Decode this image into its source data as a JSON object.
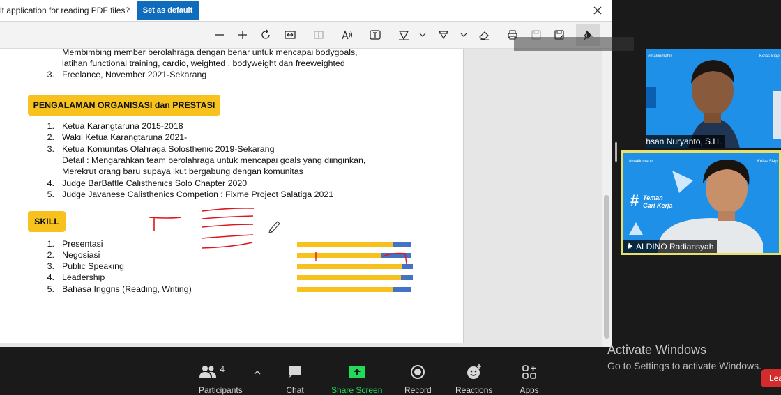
{
  "infobar": {
    "message": "lt application for reading PDF files?",
    "set_default_label": "Set as default"
  },
  "toolbar": {
    "icons": [
      "zoom-out-icon",
      "zoom-in-icon",
      "rotate-icon",
      "fit-page-icon",
      "page-view-icon",
      "read-aloud-icon",
      "text-icon",
      "draw-icon",
      "highlight-icon",
      "eraser-icon",
      "print-icon",
      "save-icon",
      "save-as-icon",
      "pin-icon"
    ]
  },
  "document": {
    "experience_lines": [
      {
        "num": "",
        "text": "Membimbing member berolahraga dengan benar untuk mencapai bodygoals,"
      },
      {
        "num": "",
        "text": "latihan functional training, cardio, weighted , bodyweight dan freeweighted"
      },
      {
        "num": "3.",
        "text": "Freelance, November 2021-Sekarang"
      }
    ],
    "org_heading": "PENGALAMAN ORGANISASI dan PRESTASI",
    "org_lines": [
      {
        "num": "1.",
        "text": "Ketua Karangtaruna 2015-2018"
      },
      {
        "num": "2.",
        "text": "Wakil Ketua Karangtaruna 2021-"
      },
      {
        "num": "3.",
        "text": "Ketua Komunitas Olahraga Solosthenic 2019-Sekarang"
      },
      {
        "num": "",
        "text": "Detail : Mengarahkan team berolahraga untuk mencapai goals yang diinginkan,"
      },
      {
        "num": "",
        "text": "Merekrut orang baru supaya ikut bergabung dengan komunitas"
      },
      {
        "num": "4.",
        "text": "Judge BarBattle Calisthenics Solo Chapter 2020"
      },
      {
        "num": "5.",
        "text": "Judge Javanese Calisthenics Competion : Fixme Project Salatiga 2021"
      }
    ],
    "skill_heading": "SKILL",
    "skills": [
      {
        "num": "1.",
        "label": "Presentasi",
        "level": 0.84
      },
      {
        "num": "2.",
        "label": "Negosiasi",
        "level": 0.74
      },
      {
        "num": "3.",
        "label": "Public Speaking",
        "level": 0.91
      },
      {
        "num": "4.",
        "label": "Leadership",
        "level": 0.9
      },
      {
        "num": "5.",
        "label": "Bahasa Inggris (Reading, Writing)",
        "level": 0.84
      }
    ]
  },
  "participants": [
    {
      "name": "Ikhsan Nuryanto, S.H."
    },
    {
      "name": "ALDINO Radiansyah"
    }
  ],
  "tile2_text": {
    "hashtag": "#makinmahir",
    "corner": "Kelas Siap",
    "big": "#",
    "line1": "Teman",
    "line2": "Cari Kerja"
  },
  "tile1_text": {
    "hashtag": "#makinmahir",
    "corner": "Kelas Siap"
  },
  "bottombar": {
    "participants_label": "Participants",
    "participants_count": "4",
    "chat_label": "Chat",
    "share_label": "Share Screen",
    "record_label": "Record",
    "reactions_label": "Reactions",
    "apps_label": "Apps",
    "leave_label": "Lea"
  },
  "watermark": {
    "line1": "Activate Windows",
    "line2": "Go to Settings to activate Windows."
  },
  "colors": {
    "accent_blue": "#0f6cbd",
    "badge_yellow": "#f7c21e",
    "bar_blue": "#4472c4",
    "share_green": "#23d959",
    "annotation_red": "#e0141e",
    "zoom_blue": "#1e90e8"
  }
}
